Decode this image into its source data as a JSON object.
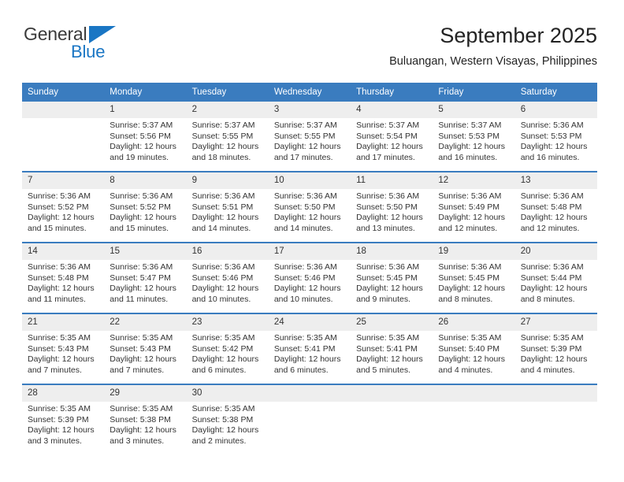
{
  "brand": {
    "name_part1": "General",
    "name_part2": "Blue",
    "icon": "triangle-logo-icon"
  },
  "header": {
    "title": "September 2025",
    "subtitle": "Buluangan, Western Visayas, Philippines"
  },
  "colors": {
    "header_blue": "#3a7cbf",
    "brand_blue": "#1a76c4",
    "daynum_band": "#eeeeee",
    "text": "#333333"
  },
  "calendar": {
    "weekday_headers": [
      "Sunday",
      "Monday",
      "Tuesday",
      "Wednesday",
      "Thursday",
      "Friday",
      "Saturday"
    ],
    "labels": {
      "sunrise": "Sunrise:",
      "sunset": "Sunset:",
      "daylight": "Daylight:"
    },
    "weeks": [
      [
        {
          "day": "",
          "blank": true
        },
        {
          "day": "1",
          "sunrise": "Sunrise: 5:37 AM",
          "sunset": "Sunset: 5:56 PM",
          "daylight": "Daylight: 12 hours and 19 minutes."
        },
        {
          "day": "2",
          "sunrise": "Sunrise: 5:37 AM",
          "sunset": "Sunset: 5:55 PM",
          "daylight": "Daylight: 12 hours and 18 minutes."
        },
        {
          "day": "3",
          "sunrise": "Sunrise: 5:37 AM",
          "sunset": "Sunset: 5:55 PM",
          "daylight": "Daylight: 12 hours and 17 minutes."
        },
        {
          "day": "4",
          "sunrise": "Sunrise: 5:37 AM",
          "sunset": "Sunset: 5:54 PM",
          "daylight": "Daylight: 12 hours and 17 minutes."
        },
        {
          "day": "5",
          "sunrise": "Sunrise: 5:37 AM",
          "sunset": "Sunset: 5:53 PM",
          "daylight": "Daylight: 12 hours and 16 minutes."
        },
        {
          "day": "6",
          "sunrise": "Sunrise: 5:36 AM",
          "sunset": "Sunset: 5:53 PM",
          "daylight": "Daylight: 12 hours and 16 minutes."
        }
      ],
      [
        {
          "day": "7",
          "sunrise": "Sunrise: 5:36 AM",
          "sunset": "Sunset: 5:52 PM",
          "daylight": "Daylight: 12 hours and 15 minutes."
        },
        {
          "day": "8",
          "sunrise": "Sunrise: 5:36 AM",
          "sunset": "Sunset: 5:52 PM",
          "daylight": "Daylight: 12 hours and 15 minutes."
        },
        {
          "day": "9",
          "sunrise": "Sunrise: 5:36 AM",
          "sunset": "Sunset: 5:51 PM",
          "daylight": "Daylight: 12 hours and 14 minutes."
        },
        {
          "day": "10",
          "sunrise": "Sunrise: 5:36 AM",
          "sunset": "Sunset: 5:50 PM",
          "daylight": "Daylight: 12 hours and 14 minutes."
        },
        {
          "day": "11",
          "sunrise": "Sunrise: 5:36 AM",
          "sunset": "Sunset: 5:50 PM",
          "daylight": "Daylight: 12 hours and 13 minutes."
        },
        {
          "day": "12",
          "sunrise": "Sunrise: 5:36 AM",
          "sunset": "Sunset: 5:49 PM",
          "daylight": "Daylight: 12 hours and 12 minutes."
        },
        {
          "day": "13",
          "sunrise": "Sunrise: 5:36 AM",
          "sunset": "Sunset: 5:48 PM",
          "daylight": "Daylight: 12 hours and 12 minutes."
        }
      ],
      [
        {
          "day": "14",
          "sunrise": "Sunrise: 5:36 AM",
          "sunset": "Sunset: 5:48 PM",
          "daylight": "Daylight: 12 hours and 11 minutes."
        },
        {
          "day": "15",
          "sunrise": "Sunrise: 5:36 AM",
          "sunset": "Sunset: 5:47 PM",
          "daylight": "Daylight: 12 hours and 11 minutes."
        },
        {
          "day": "16",
          "sunrise": "Sunrise: 5:36 AM",
          "sunset": "Sunset: 5:46 PM",
          "daylight": "Daylight: 12 hours and 10 minutes."
        },
        {
          "day": "17",
          "sunrise": "Sunrise: 5:36 AM",
          "sunset": "Sunset: 5:46 PM",
          "daylight": "Daylight: 12 hours and 10 minutes."
        },
        {
          "day": "18",
          "sunrise": "Sunrise: 5:36 AM",
          "sunset": "Sunset: 5:45 PM",
          "daylight": "Daylight: 12 hours and 9 minutes."
        },
        {
          "day": "19",
          "sunrise": "Sunrise: 5:36 AM",
          "sunset": "Sunset: 5:45 PM",
          "daylight": "Daylight: 12 hours and 8 minutes."
        },
        {
          "day": "20",
          "sunrise": "Sunrise: 5:36 AM",
          "sunset": "Sunset: 5:44 PM",
          "daylight": "Daylight: 12 hours and 8 minutes."
        }
      ],
      [
        {
          "day": "21",
          "sunrise": "Sunrise: 5:35 AM",
          "sunset": "Sunset: 5:43 PM",
          "daylight": "Daylight: 12 hours and 7 minutes."
        },
        {
          "day": "22",
          "sunrise": "Sunrise: 5:35 AM",
          "sunset": "Sunset: 5:43 PM",
          "daylight": "Daylight: 12 hours and 7 minutes."
        },
        {
          "day": "23",
          "sunrise": "Sunrise: 5:35 AM",
          "sunset": "Sunset: 5:42 PM",
          "daylight": "Daylight: 12 hours and 6 minutes."
        },
        {
          "day": "24",
          "sunrise": "Sunrise: 5:35 AM",
          "sunset": "Sunset: 5:41 PM",
          "daylight": "Daylight: 12 hours and 6 minutes."
        },
        {
          "day": "25",
          "sunrise": "Sunrise: 5:35 AM",
          "sunset": "Sunset: 5:41 PM",
          "daylight": "Daylight: 12 hours and 5 minutes."
        },
        {
          "day": "26",
          "sunrise": "Sunrise: 5:35 AM",
          "sunset": "Sunset: 5:40 PM",
          "daylight": "Daylight: 12 hours and 4 minutes."
        },
        {
          "day": "27",
          "sunrise": "Sunrise: 5:35 AM",
          "sunset": "Sunset: 5:39 PM",
          "daylight": "Daylight: 12 hours and 4 minutes."
        }
      ],
      [
        {
          "day": "28",
          "sunrise": "Sunrise: 5:35 AM",
          "sunset": "Sunset: 5:39 PM",
          "daylight": "Daylight: 12 hours and 3 minutes."
        },
        {
          "day": "29",
          "sunrise": "Sunrise: 5:35 AM",
          "sunset": "Sunset: 5:38 PM",
          "daylight": "Daylight: 12 hours and 3 minutes."
        },
        {
          "day": "30",
          "sunrise": "Sunrise: 5:35 AM",
          "sunset": "Sunset: 5:38 PM",
          "daylight": "Daylight: 12 hours and 2 minutes."
        },
        {
          "day": "",
          "blank": true
        },
        {
          "day": "",
          "blank": true
        },
        {
          "day": "",
          "blank": true
        },
        {
          "day": "",
          "blank": true
        }
      ]
    ]
  }
}
